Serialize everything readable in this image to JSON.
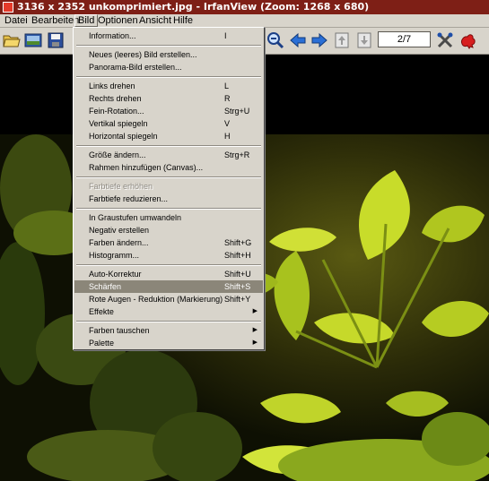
{
  "window": {
    "title": "3136 x 2352 unkomprimiert.jpg - IrfanView (Zoom: 1268 x 680)",
    "accent_color": "#7e1f16"
  },
  "menubar": {
    "items": [
      "Datei",
      "Bearbeiten",
      "Bild",
      "Optionen",
      "Ansicht",
      "Hilfe"
    ],
    "active": "Bild"
  },
  "toolbar": {
    "page_indicator": "2/7",
    "icons": [
      "open-folder-icon",
      "slideshow-icon",
      "save-icon",
      "zoom-out-icon",
      "previous-arrow-icon",
      "next-arrow-icon",
      "first-page-icon",
      "last-page-icon",
      "settings-icon",
      "irfanview-logo-icon"
    ]
  },
  "bild_menu": {
    "items": [
      {
        "label": "Information...",
        "shortcut": "I"
      },
      {
        "label": "Neues (leeres) Bild erstellen...",
        "shortcut": ""
      },
      {
        "label": "Panorama-Bild erstellen...",
        "shortcut": ""
      },
      {
        "label": "Links drehen",
        "shortcut": "L"
      },
      {
        "label": "Rechts drehen",
        "shortcut": "R"
      },
      {
        "label": "Fein-Rotation...",
        "shortcut": "Strg+U"
      },
      {
        "label": "Vertikal spiegeln",
        "shortcut": "V"
      },
      {
        "label": "Horizontal spiegeln",
        "shortcut": "H"
      },
      {
        "label": "Größe ändern...",
        "shortcut": "Strg+R"
      },
      {
        "label": "Rahmen hinzufügen (Canvas)...",
        "shortcut": ""
      },
      {
        "label": "Farbtiefe erhöhen",
        "shortcut": "",
        "disabled": true
      },
      {
        "label": "Farbtiefe reduzieren...",
        "shortcut": ""
      },
      {
        "label": "In Graustufen umwandeln",
        "shortcut": ""
      },
      {
        "label": "Negativ erstellen",
        "shortcut": ""
      },
      {
        "label": "Farben ändern...",
        "shortcut": "Shift+G"
      },
      {
        "label": "Histogramm...",
        "shortcut": "Shift+H"
      },
      {
        "label": "Auto-Korrektur",
        "shortcut": "Shift+U"
      },
      {
        "label": "Schärfen",
        "shortcut": "Shift+S",
        "selected": true
      },
      {
        "label": "Rote Augen - Reduktion (Markierung)",
        "shortcut": "Shift+Y"
      },
      {
        "label": "Effekte",
        "shortcut": "",
        "submenu": true
      },
      {
        "label": "Farben tauschen",
        "shortcut": "",
        "submenu": true
      },
      {
        "label": "Palette",
        "shortcut": "",
        "submenu": true
      }
    ]
  }
}
